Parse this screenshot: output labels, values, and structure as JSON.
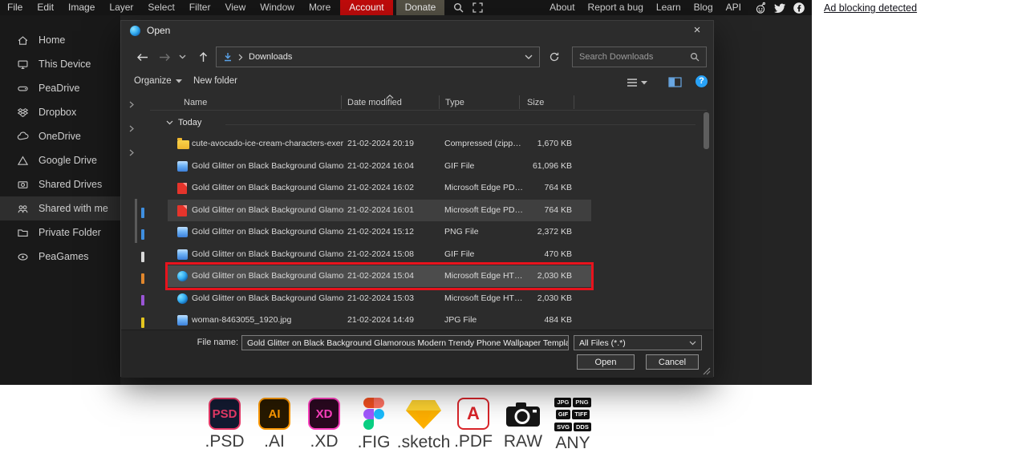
{
  "menubar": {
    "items": [
      "File",
      "Edit",
      "Image",
      "Layer",
      "Select",
      "Filter",
      "View",
      "Window",
      "More"
    ],
    "account_label": "Account",
    "donate_label": "Donate",
    "right_items": [
      "About",
      "Report a bug",
      "Learn",
      "Blog",
      "API"
    ]
  },
  "ad_banner": {
    "text": "Ad blocking detected"
  },
  "sidebar": {
    "items": [
      {
        "label": "Home"
      },
      {
        "label": "This Device"
      },
      {
        "label": "PeaDrive"
      },
      {
        "label": "Dropbox"
      },
      {
        "label": "OneDrive"
      },
      {
        "label": "Google Drive"
      },
      {
        "label": "Shared Drives"
      },
      {
        "label": "Shared with me"
      },
      {
        "label": "Private Folder"
      },
      {
        "label": "PeaGames"
      }
    ]
  },
  "dialog": {
    "title": "Open",
    "nav": {
      "location": "Downloads",
      "search_placeholder": "Search Downloads"
    },
    "toolbar": {
      "organize_label": "Organize",
      "new_folder_label": "New folder"
    },
    "columns": [
      "Name",
      "Date modified",
      "Type",
      "Size"
    ],
    "group_label": "Today",
    "rows": [
      {
        "name": "cute-avocado-ice-cream-characters-exer…",
        "date": "21-02-2024 20:19",
        "type": "Compressed (zipp…",
        "size": "1,670 KB",
        "icon": "folder"
      },
      {
        "name": "Gold Glitter on Black Background Glamor…",
        "date": "21-02-2024 16:04",
        "type": "GIF File",
        "size": "61,096 KB",
        "icon": "image"
      },
      {
        "name": "Gold Glitter on Black Background Glamor…",
        "date": "21-02-2024 16:02",
        "type": "Microsoft Edge PD…",
        "size": "764 KB",
        "icon": "pdf"
      },
      {
        "name": "Gold Glitter on Black Background Glamor…",
        "date": "21-02-2024 16:01",
        "type": "Microsoft Edge PD…",
        "size": "764 KB",
        "icon": "pdf"
      },
      {
        "name": "Gold Glitter on Black Background Glamor…",
        "date": "21-02-2024 15:12",
        "type": "PNG File",
        "size": "2,372 KB",
        "icon": "image"
      },
      {
        "name": "Gold Glitter on Black Background Glamor…",
        "date": "21-02-2024 15:08",
        "type": "GIF File",
        "size": "470 KB",
        "icon": "image"
      },
      {
        "name": "Gold Glitter on Black Background Glamor…",
        "date": "21-02-2024 15:04",
        "type": "Microsoft Edge HT…",
        "size": "2,030 KB",
        "icon": "edge"
      },
      {
        "name": "Gold Glitter on Black Background Glamor…",
        "date": "21-02-2024 15:03",
        "type": "Microsoft Edge HT…",
        "size": "2,030 KB",
        "icon": "edge"
      },
      {
        "name": "woman-8463055_1920.jpg",
        "date": "21-02-2024 14:49",
        "type": "JPG File",
        "size": "484 KB",
        "icon": "image"
      }
    ],
    "footer": {
      "file_name_label": "File name:",
      "file_name_value": "Gold Glitter on Black Background Glamorous Modern Trendy Phone Wallpaper Template",
      "file_type_value": "All Files (*.*)",
      "open_label": "Open",
      "cancel_label": "Cancel"
    },
    "colors": {
      "selection_annotation": "#e8131d"
    }
  },
  "formats": {
    "items": [
      {
        "label": ".PSD",
        "badge": "PSD"
      },
      {
        "label": ".AI",
        "badge": "AI"
      },
      {
        "label": ".XD",
        "badge": "XD"
      },
      {
        "label": ".FIG",
        "badge": ""
      },
      {
        "label": ".sketch",
        "badge": ""
      },
      {
        "label": ".PDF",
        "badge": "A"
      },
      {
        "label": "RAW",
        "badge": ""
      },
      {
        "label": "ANY",
        "badge": ""
      }
    ],
    "any_badges": [
      "JPG",
      "PNG",
      "GIF",
      "TIFF",
      "SVG",
      "DDS"
    ]
  }
}
